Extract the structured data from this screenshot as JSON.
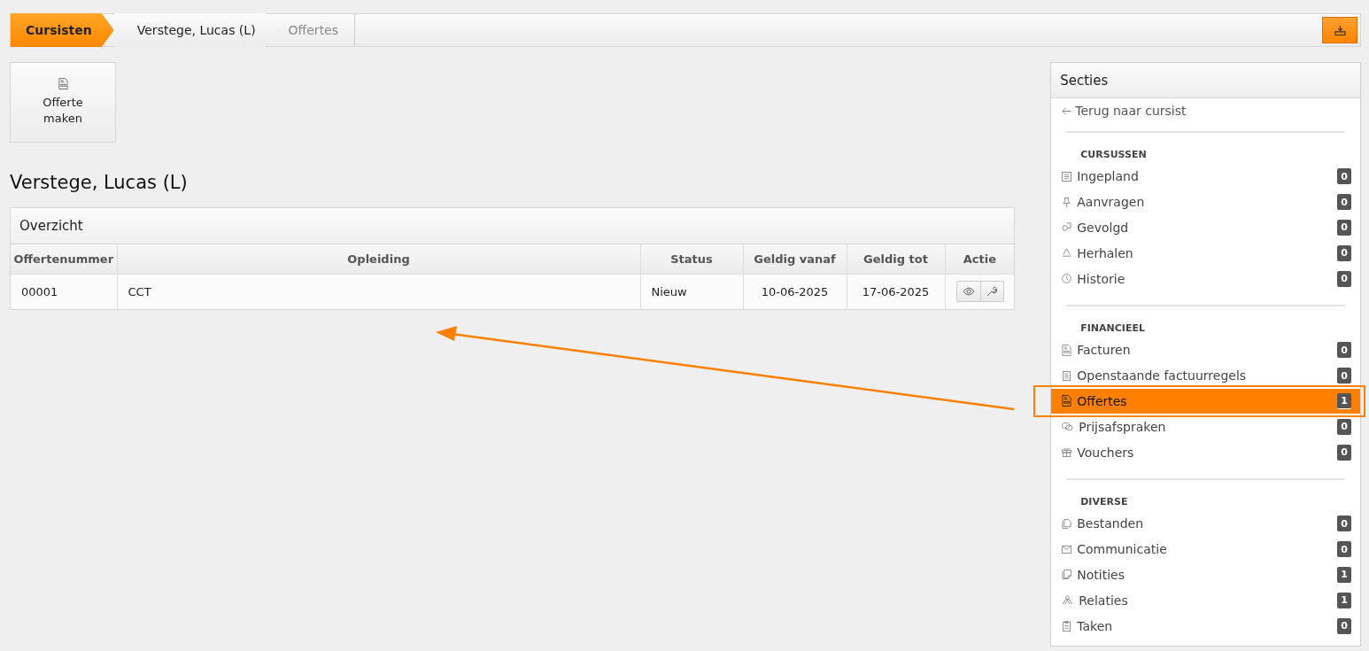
{
  "breadcrumb": [
    {
      "label": "Cursisten",
      "kind": "root"
    },
    {
      "label": "Verstege, Lucas (L)",
      "kind": "link"
    },
    {
      "label": "Offertes",
      "kind": "current"
    }
  ],
  "toolbar": {
    "buttons": [
      {
        "label": "Offerte\nmaken"
      }
    ]
  },
  "heading": "Verstege, Lucas (L)",
  "panel": {
    "title": "Overzicht",
    "table": {
      "columns": [
        "Offertenummer",
        "Opleiding",
        "Status",
        "Geldig vanaf",
        "Geldig tot",
        "Actie"
      ],
      "rows": [
        {
          "cells": [
            "00001",
            "CCT",
            "Nieuw",
            "10-06-2025",
            "17-06-2025"
          ]
        }
      ]
    }
  },
  "sidebar": {
    "title": "Secties",
    "back_link": "Terug naar cursist",
    "groups": [
      {
        "heading": "CURSUSSEN",
        "items": [
          {
            "label": "Ingepland",
            "count": "0",
            "selected": false
          },
          {
            "label": "Aanvragen",
            "count": "0",
            "selected": false
          },
          {
            "label": "Gevolgd",
            "count": "0",
            "selected": false
          },
          {
            "label": "Herhalen",
            "count": "0",
            "selected": false
          },
          {
            "label": "Historie",
            "count": "0",
            "selected": false
          }
        ]
      },
      {
        "heading": "FINANCIEEL",
        "items": [
          {
            "label": "Facturen",
            "count": "0",
            "selected": false
          },
          {
            "label": "Openstaande factuurregels",
            "count": "0",
            "selected": false
          },
          {
            "label": "Offertes",
            "count": "1",
            "selected": true
          },
          {
            "label": "Prijsafspraken",
            "count": "0",
            "selected": false
          },
          {
            "label": "Vouchers",
            "count": "0",
            "selected": false
          }
        ]
      },
      {
        "heading": "DIVERSE",
        "items": [
          {
            "label": "Bestanden",
            "count": "0",
            "selected": false
          },
          {
            "label": "Communicatie",
            "count": "0",
            "selected": false
          },
          {
            "label": "Notities",
            "count": "1",
            "selected": false
          },
          {
            "label": "Relaties",
            "count": "1",
            "selected": false
          },
          {
            "label": "Taken",
            "count": "0",
            "selected": false
          }
        ]
      }
    ]
  }
}
